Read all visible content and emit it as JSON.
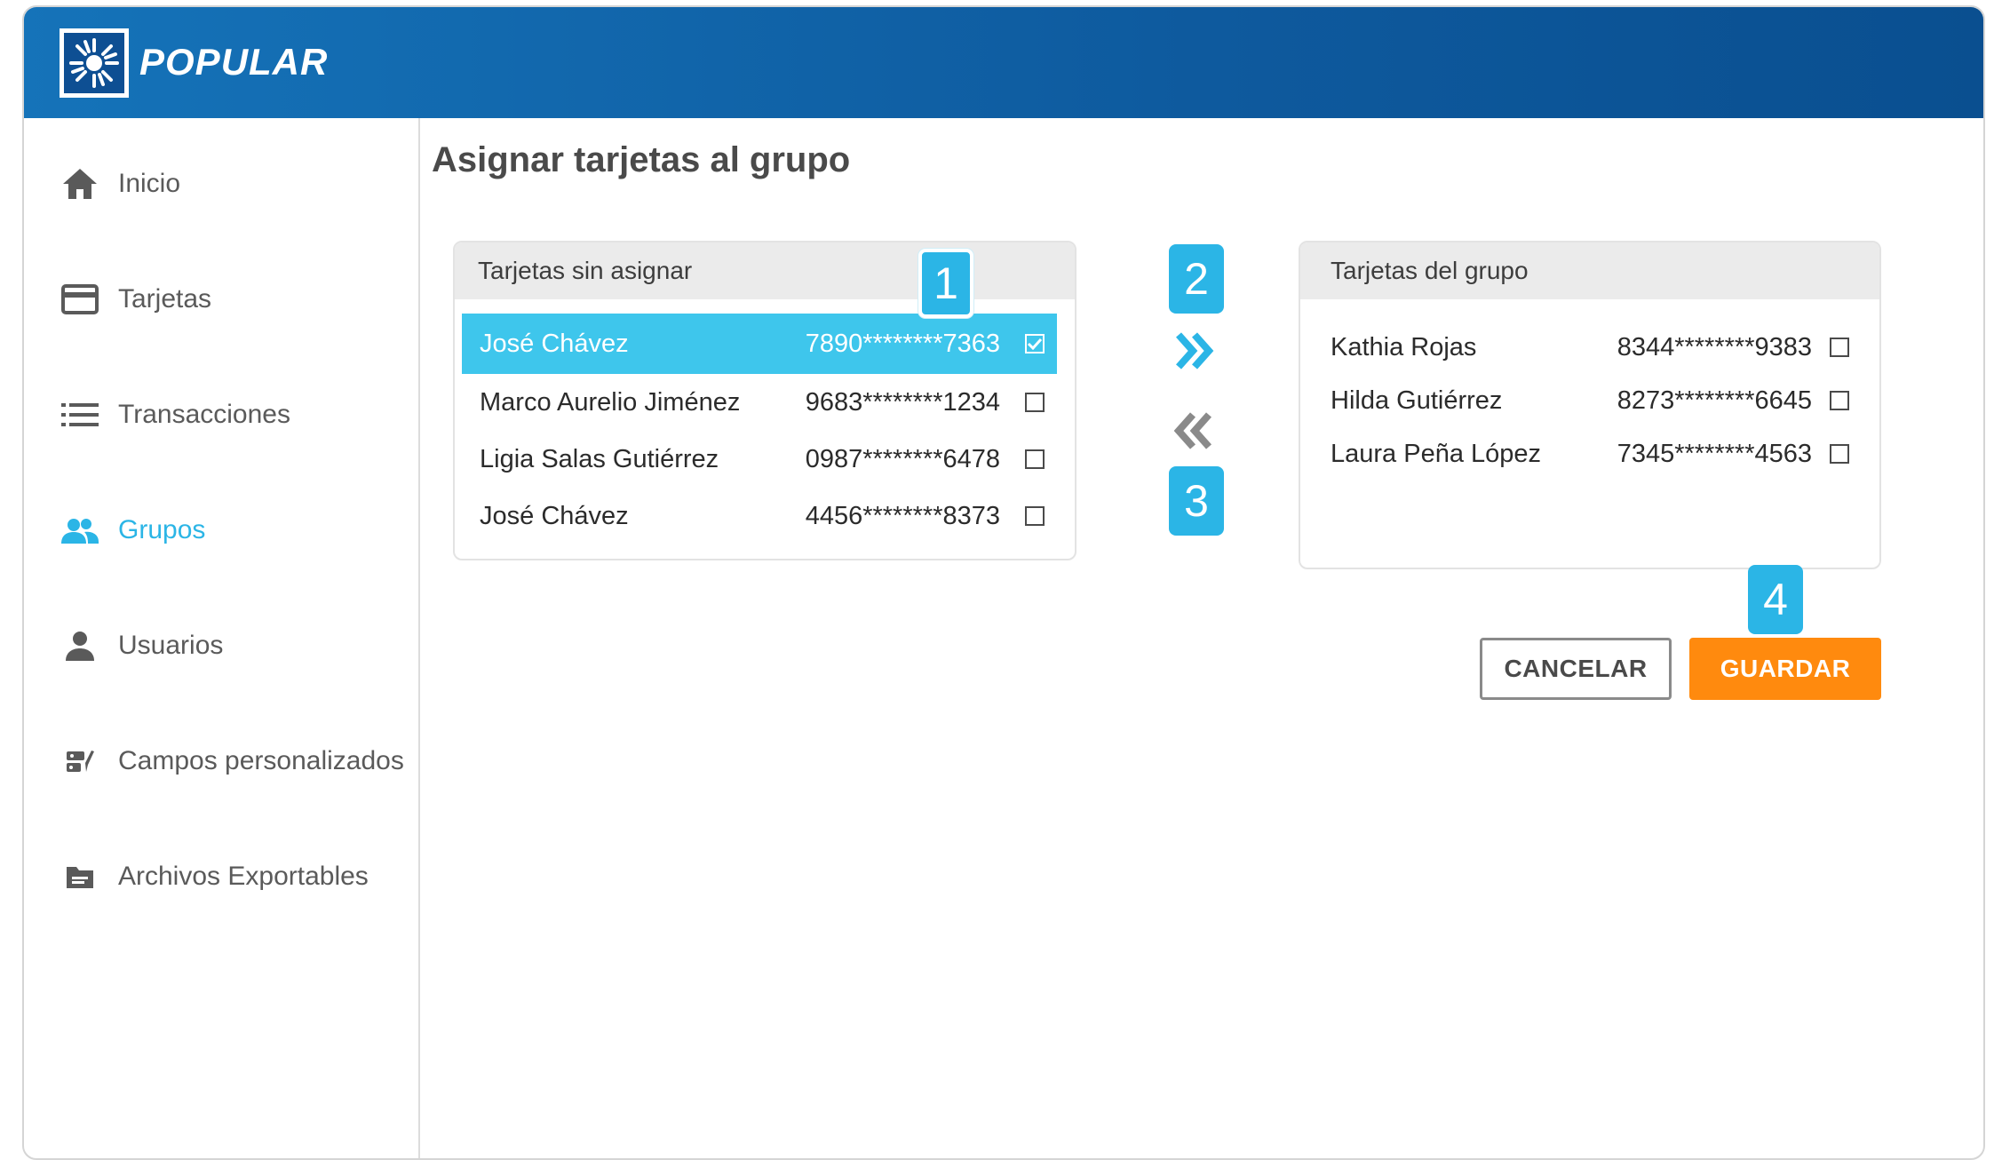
{
  "brand": {
    "name": "POPULAR",
    "primary_color": "#1573b9",
    "accent_color": "#2bb5e6",
    "save_color": "#ff8a0e"
  },
  "sidebar": {
    "items": [
      {
        "label": "Inicio",
        "icon": "home-icon",
        "active": false
      },
      {
        "label": "Tarjetas",
        "icon": "credit-card-icon",
        "active": false
      },
      {
        "label": "Transacciones",
        "icon": "list-icon",
        "active": false
      },
      {
        "label": "Grupos",
        "icon": "group-icon",
        "active": true
      },
      {
        "label": "Usuarios",
        "icon": "user-icon",
        "active": false
      },
      {
        "label": "Campos personalizados",
        "icon": "custom-fields-icon",
        "active": false
      },
      {
        "label": "Archivos Exportables",
        "icon": "folder-icon",
        "active": false
      }
    ]
  },
  "main": {
    "title": "Asignar tarjetas al grupo",
    "unassigned": {
      "header": "Tarjetas sin asignar",
      "rows": [
        {
          "name": "José Chávez",
          "card": "7890********7363",
          "checked": true
        },
        {
          "name": "Marco Aurelio Jiménez",
          "card": "9683********1234",
          "checked": false
        },
        {
          "name": "Ligia Salas Gutiérrez",
          "card": "0987********6478",
          "checked": false
        },
        {
          "name": "José Chávez",
          "card": "4456********8373",
          "checked": false
        }
      ]
    },
    "group": {
      "header": "Tarjetas del grupo",
      "rows": [
        {
          "name": "Kathia Rojas",
          "card": "8344********9383",
          "checked": false
        },
        {
          "name": "Hilda Gutiérrez",
          "card": "8273********6645",
          "checked": false
        },
        {
          "name": "Laura Peña López",
          "card": "7345********4563",
          "checked": false
        }
      ]
    },
    "steps": [
      "1",
      "2",
      "3",
      "4"
    ],
    "buttons": {
      "cancel": "CANCELAR",
      "save": "GUARDAR"
    }
  }
}
